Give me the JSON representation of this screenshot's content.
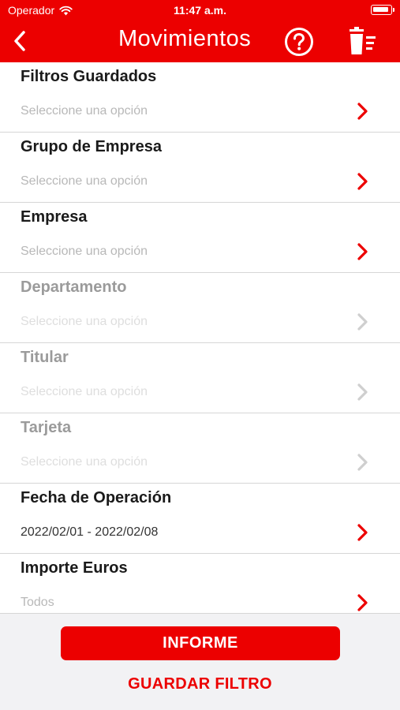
{
  "status_bar": {
    "carrier": "Operador",
    "time": "11:47 a.m."
  },
  "header": {
    "title": "Movimientos",
    "back_icon": "chevron-left-icon",
    "help_icon": "help-circle-icon",
    "trash_icon": "trash-filter-icon"
  },
  "colors": {
    "brand": "#ec0000",
    "disabled_text": "#9b9b9b",
    "placeholder": "#b8b8b8"
  },
  "filters": [
    {
      "label": "Filtros Guardados",
      "value": "Seleccione una opción",
      "enabled": true,
      "filled": false
    },
    {
      "label": "Grupo de Empresa",
      "value": "Seleccione una opción",
      "enabled": true,
      "filled": false
    },
    {
      "label": "Empresa",
      "value": "Seleccione una opción",
      "enabled": true,
      "filled": false
    },
    {
      "label": "Departamento",
      "value": "Seleccione una opción",
      "enabled": false,
      "filled": false
    },
    {
      "label": "Titular",
      "value": "Seleccione una opción",
      "enabled": false,
      "filled": false
    },
    {
      "label": "Tarjeta",
      "value": "Seleccione una opción",
      "enabled": false,
      "filled": false
    },
    {
      "label": "Fecha de Operación",
      "value": "2022/02/01 - 2022/02/08",
      "enabled": true,
      "filled": true
    },
    {
      "label": "Importe Euros",
      "value": "Todos",
      "enabled": true,
      "filled": false
    }
  ],
  "footer": {
    "report_button": "INFORME",
    "save_filter_button": "GUARDAR FILTRO"
  }
}
